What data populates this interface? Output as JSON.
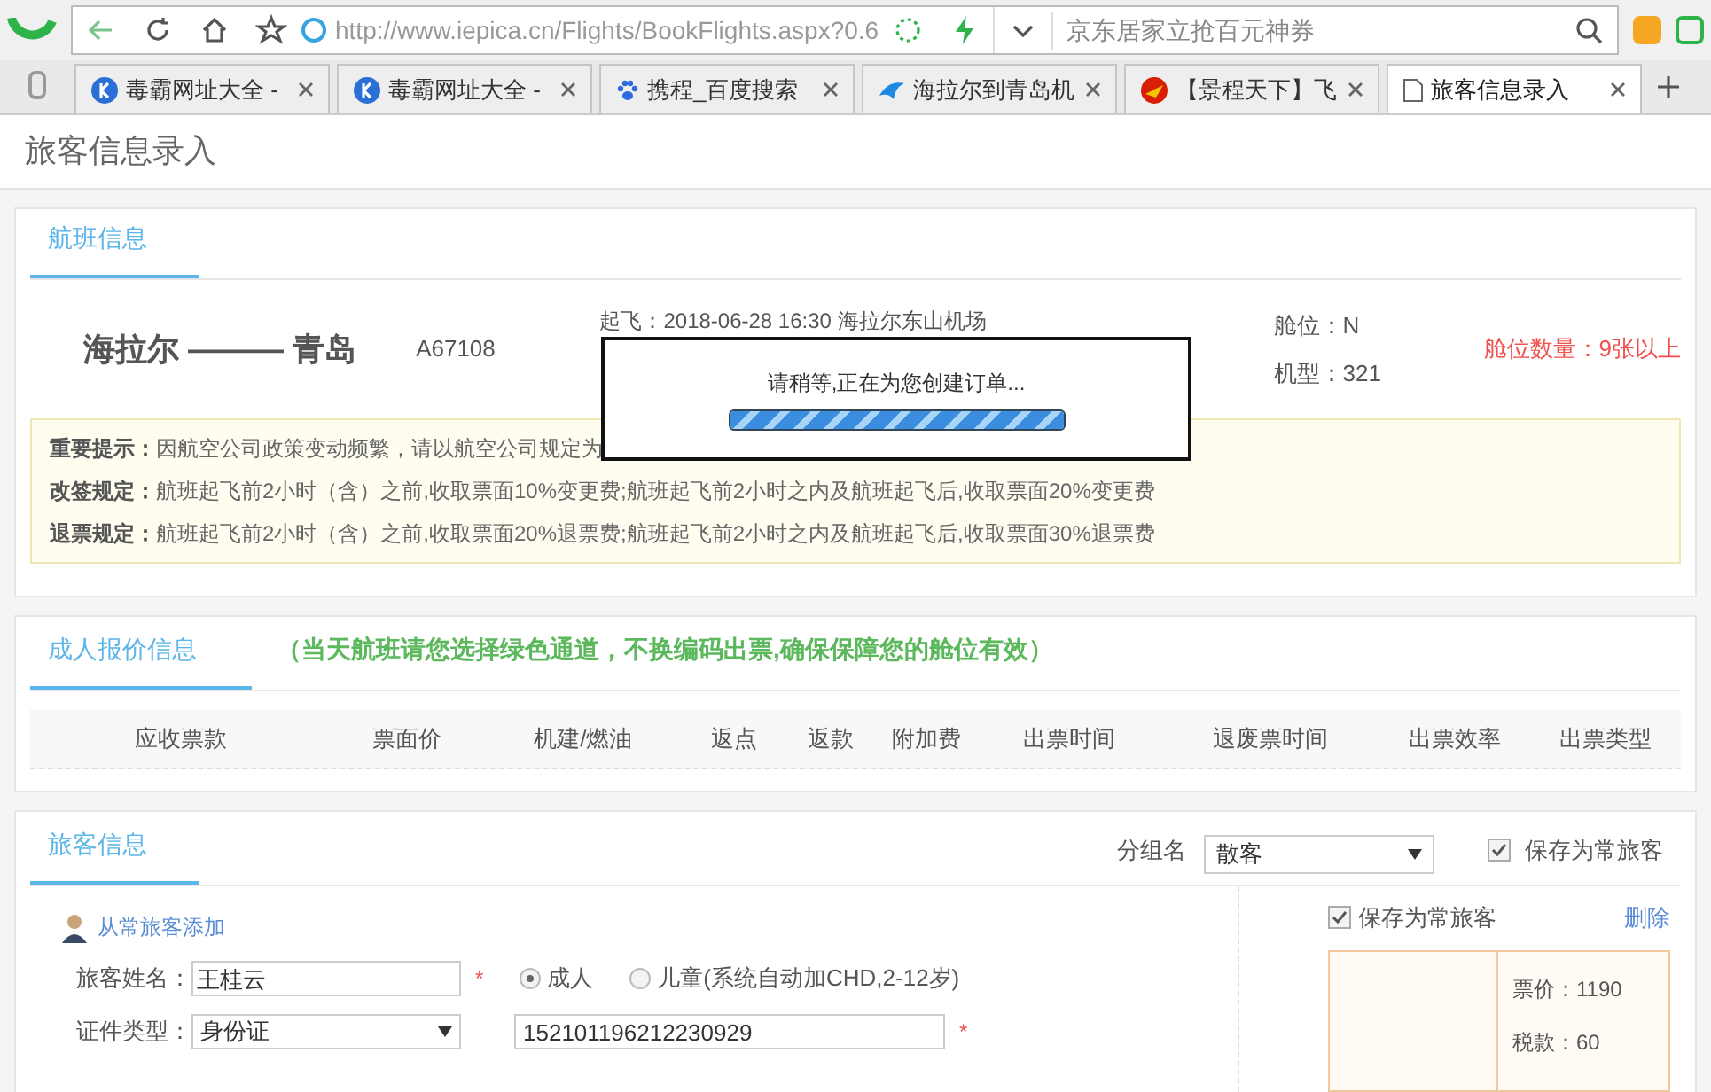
{
  "browser": {
    "url": "http://www.iepica.cn/Flights/BookFlights.aspx?0.6",
    "search_placeholder": "京东居家立抢百元神券",
    "tabs": [
      {
        "label": "毒霸网址大全 -",
        "selected": false
      },
      {
        "label": "毒霸网址大全 -",
        "selected": false
      },
      {
        "label": "携程_百度搜索",
        "selected": false
      },
      {
        "label": "海拉尔到青岛机",
        "selected": false
      },
      {
        "label": "【景程天下】飞",
        "selected": false
      },
      {
        "label": "旅客信息录入",
        "selected": true
      }
    ]
  },
  "page_title": "旅客信息录入",
  "flight": {
    "tab": "航班信息",
    "route_from": "海拉尔",
    "route_separator": "———",
    "route_to": "青岛",
    "flight_no": "A67108",
    "departure": "起飞：2018-06-28 16:30 海拉尔东山机场",
    "cabin": "舱位：N",
    "aircraft": "机型：321",
    "seats": "舱位数量：9张以上",
    "notices": [
      {
        "label": "重要提示：",
        "text": "因航空公司政策变动频繁，请以航空公司规定为"
      },
      {
        "label": "改签规定：",
        "text": "航班起飞前2小时（含）之前,收取票面10%变更费;航班起飞前2小时之内及航班起飞后,收取票面20%变更费"
      },
      {
        "label": "退票规定：",
        "text": "航班起飞前2小时（含）之前,收取票面20%退票费;航班起飞前2小时之内及航班起飞后,收取票面30%退票费"
      }
    ]
  },
  "modal": {
    "message": "请稍等,正在为您创建订单...",
    "level": 1
  },
  "pricing": {
    "tab": "成人报价信息",
    "hint": "（当天航班请您选择绿色通道，不换编码出票,确保保障您的舱位有效）",
    "columns": [
      "应收票款",
      "票面价",
      "机建/燃油",
      "返点",
      "返款",
      "附加费",
      "出票时间",
      "退废票时间",
      "出票效率",
      "出票类型"
    ]
  },
  "passenger": {
    "tab": "旅客信息",
    "group_label": "分组名",
    "group_value": "散客",
    "save_all": {
      "label": "保存为常旅客",
      "checked": true
    },
    "add_frequent": "从常旅客添加",
    "name_label": "旅客姓名：",
    "name_value": "王桂云",
    "required_mark": "*",
    "types": [
      {
        "label": "成人",
        "selected": true
      },
      {
        "label": "儿童(系统自动加CHD,2-12岁)",
        "selected": false
      }
    ],
    "id_type_label": "证件类型：",
    "id_type_value": "身份证",
    "id_number": "152101196212230929",
    "id_required_mark": "*",
    "save_one": {
      "label": "保存为常旅客",
      "checked": true
    },
    "delete": "删除",
    "fare": "票价：1190",
    "tax": "税款：60"
  }
}
